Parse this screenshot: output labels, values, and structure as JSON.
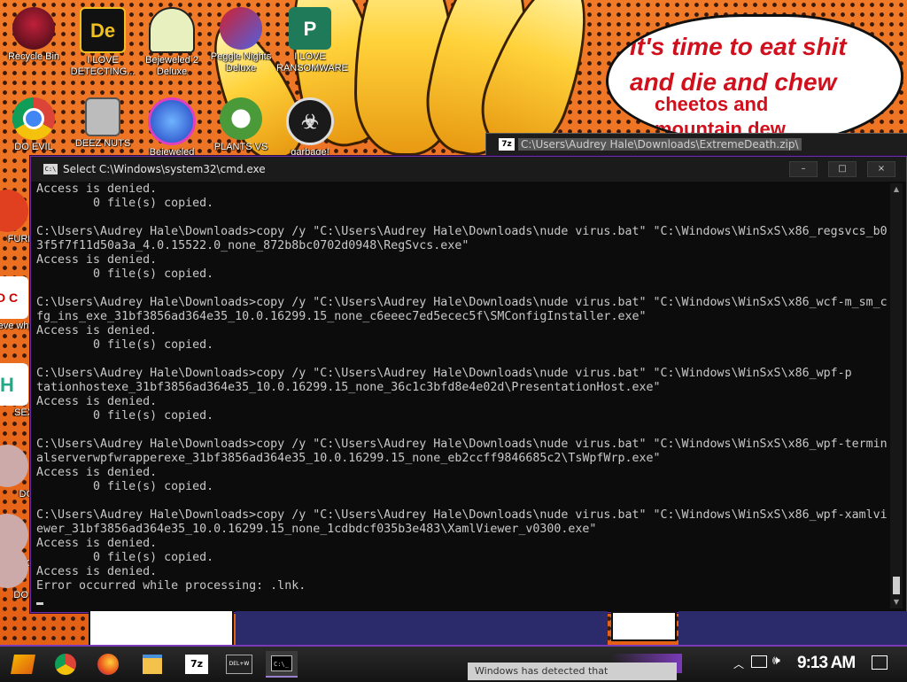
{
  "wallpaper": {
    "speech": {
      "line1": "it's time to eat shit",
      "line2": "and die and chew",
      "line3": "cheetos and",
      "line4": "mountain dew"
    },
    "accent_color": "#e8691e"
  },
  "desktop_icons": [
    {
      "label": "Recycle Bin",
      "icon": "recycle-bin-icon"
    },
    {
      "label": "I LOVE DETECTING...",
      "icon": "detector-app-icon",
      "glyph": "De"
    },
    {
      "label": "Bejeweled 2 Deluxe",
      "icon": "bejeweled-2-icon"
    },
    {
      "label": "Peggle Nights Deluxe",
      "icon": "peggle-icon"
    },
    {
      "label": "I LOVE RANSOMWARE",
      "icon": "publisher-icon",
      "glyph": "P"
    },
    {
      "label": "DO EVIL",
      "icon": "chrome-icon"
    },
    {
      "label": "DEEZ NUTS",
      "icon": "copy-files-icon"
    },
    {
      "label": "Bejeweled",
      "icon": "bejeweled-icon"
    },
    {
      "label": "PLANTS VS",
      "icon": "plants-vs-zombies-icon"
    },
    {
      "label": "garbage!",
      "icon": "biohazard-icon"
    },
    {
      "label": "FURF",
      "icon": "partial-icon-1"
    },
    {
      "label": "neve why",
      "icon": "partial-icon-2"
    },
    {
      "label": "SEX",
      "icon": "partial-icon-3"
    },
    {
      "label": "DO",
      "icon": "partial-icon-4"
    },
    {
      "label": "DO",
      "icon": "partial-icon-5"
    },
    {
      "label": "DO I",
      "icon": "partial-icon-6"
    }
  ],
  "bg_window": {
    "title": "C:\\Users\\Audrey Hale\\Downloads\\ExtremeDeath.zip\\",
    "icon_text": "7z"
  },
  "cmd_window": {
    "title": "Select C:\\Windows\\system32\\cmd.exe",
    "icon_text": "C:\\",
    "minimize": "–",
    "maximize": "□",
    "close": "×",
    "lines": [
      "Access is denied.",
      "        0 file(s) copied.",
      "",
      "C:\\Users\\Audrey Hale\\Downloads>copy /y \"C:\\Users\\Audrey Hale\\Downloads\\nude virus.bat\" \"C:\\Windows\\WinSxS\\x86_regsvcs_b0",
      "3f5f7f11d50a3a_4.0.15522.0_none_872b8bc0702d0948\\RegSvcs.exe\"",
      "Access is denied.",
      "        0 file(s) copied.",
      "",
      "C:\\Users\\Audrey Hale\\Downloads>copy /y \"C:\\Users\\Audrey Hale\\Downloads\\nude virus.bat\" \"C:\\Windows\\WinSxS\\x86_wcf-m_sm_c",
      "fg_ins_exe_31bf3856ad364e35_10.0.16299.15_none_c6eeec7ed5ecec5f\\SMConfigInstaller.exe\"",
      "Access is denied.",
      "        0 file(s) copied.",
      "",
      "C:\\Users\\Audrey Hale\\Downloads>copy /y \"C:\\Users\\Audrey Hale\\Downloads\\nude virus.bat\" \"C:\\Windows\\WinSxS\\x86_wpf-p",
      "tationhostexe_31bf3856ad364e35_10.0.16299.15_none_36c1c3bfd8e4e02d\\PresentationHost.exe\"",
      "Access is denied.",
      "        0 file(s) copied.",
      "",
      "C:\\Users\\Audrey Hale\\Downloads>copy /y \"C:\\Users\\Audrey Hale\\Downloads\\nude virus.bat\" \"C:\\Windows\\WinSxS\\x86_wpf-termin",
      "alserverwpfwrapperexe_31bf3856ad364e35_10.0.16299.15_none_eb2ccff9846685c2\\TsWpfWrp.exe\"",
      "Access is denied.",
      "        0 file(s) copied.",
      "",
      "C:\\Users\\Audrey Hale\\Downloads>copy /y \"C:\\Users\\Audrey Hale\\Downloads\\nude virus.bat\" \"C:\\Windows\\WinSxS\\x86_wpf-xamlvi",
      "ewer_31bf3856ad364e35_10.0.16299.15_none_1cdbdcf035b3e483\\XamlViewer_v0300.exe\"",
      "Access is denied.",
      "        0 file(s) copied.",
      "Access is denied.",
      "Error occurred while processing: .lnk."
    ]
  },
  "taskbar": {
    "items": [
      {
        "icon": "start-icon",
        "active": false
      },
      {
        "icon": "chrome-icon",
        "active": false
      },
      {
        "icon": "firefox-icon",
        "active": false
      },
      {
        "icon": "file-explorer-icon",
        "active": false
      },
      {
        "icon": "7zip-icon",
        "active": false,
        "text": "7z"
      },
      {
        "icon": "delete-key-icon",
        "active": false,
        "text": "DEL+W"
      },
      {
        "icon": "cmd-icon",
        "active": true,
        "text": "C:\\_"
      }
    ],
    "clock": "9:13 AM",
    "toast": "Windows has detected that"
  }
}
